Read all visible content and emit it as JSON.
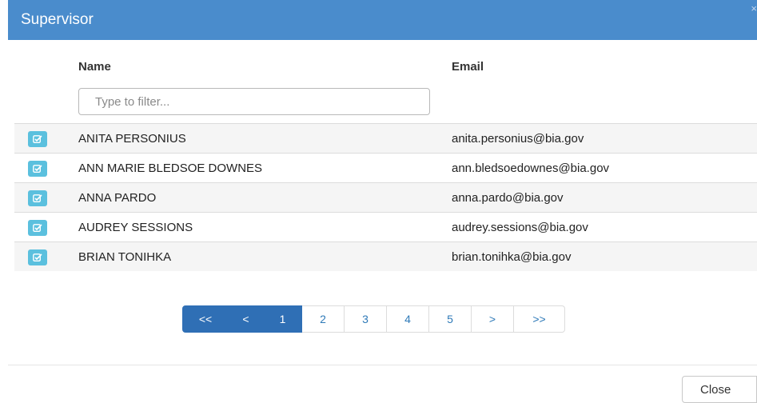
{
  "modal": {
    "title": "Supervisor",
    "close_glyph": "×"
  },
  "table": {
    "columns": {
      "name": "Name",
      "email": "Email"
    },
    "filter": {
      "placeholder": "Type to filter...",
      "value": ""
    },
    "rows": [
      {
        "name": "ANITA PERSONIUS",
        "email": "anita.personius@bia.gov"
      },
      {
        "name": "ANN MARIE BLEDSOE DOWNES",
        "email": "ann.bledsoedownes@bia.gov"
      },
      {
        "name": "ANNA PARDO",
        "email": "anna.pardo@bia.gov"
      },
      {
        "name": "AUDREY SESSIONS",
        "email": "audrey.sessions@bia.gov"
      },
      {
        "name": "BRIAN TONIHKA",
        "email": "brian.tonihka@bia.gov"
      }
    ],
    "row_icon": "edit-check-icon"
  },
  "pagination": {
    "items": [
      {
        "label": "<<",
        "active": true
      },
      {
        "label": "<",
        "active": true
      },
      {
        "label": "1",
        "active": true
      },
      {
        "label": "2",
        "active": false
      },
      {
        "label": "3",
        "active": false
      },
      {
        "label": "4",
        "active": false
      },
      {
        "label": "5",
        "active": false
      },
      {
        "label": ">",
        "active": false
      },
      {
        "label": ">>",
        "active": false
      }
    ],
    "current_page": 1
  },
  "footer": {
    "close_label": "Close"
  },
  "colors": {
    "header_bg": "#4a8ccc",
    "select_button": "#5bc0de",
    "pagination_active": "#2f6fb5",
    "link": "#2f7ab8"
  }
}
